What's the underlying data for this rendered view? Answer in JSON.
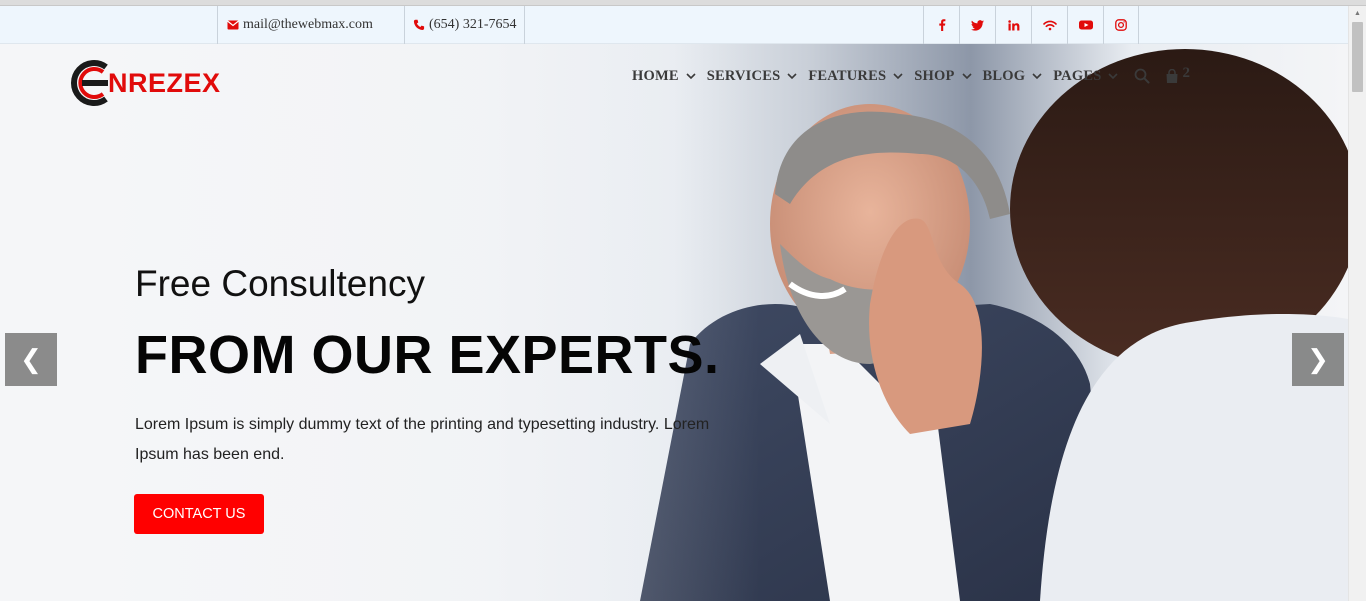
{
  "topbar": {
    "email": "mail@thewebmax.com",
    "phone": "(654) 321-7654",
    "social": [
      {
        "name": "facebook-icon",
        "glyph": "f"
      },
      {
        "name": "twitter-icon",
        "glyph": "twitter"
      },
      {
        "name": "linkedin-icon",
        "glyph": "in"
      },
      {
        "name": "wifi-icon",
        "glyph": "wifi"
      },
      {
        "name": "youtube-icon",
        "glyph": "youtube"
      },
      {
        "name": "instagram-icon",
        "glyph": "instagram"
      }
    ]
  },
  "brand": {
    "name": "NREZEX",
    "accent": "#e10b0b"
  },
  "nav": {
    "items": [
      "HOME",
      "SERVICES",
      "FEATURES",
      "SHOP",
      "BLOG",
      "PAGES"
    ],
    "cart_count": "2"
  },
  "hero": {
    "subtitle": "Free Consultency",
    "title": "FROM OUR EXPERTS.",
    "description": "Lorem Ipsum is simply dummy text of the printing and typesetting industry. Lorem Ipsum has been end.",
    "cta_label": "CONTACT US",
    "prev_label": "❮",
    "next_label": "❯"
  },
  "colors": {
    "topbar_bg": "#eef6fd",
    "cta_bg": "#ff0000"
  }
}
